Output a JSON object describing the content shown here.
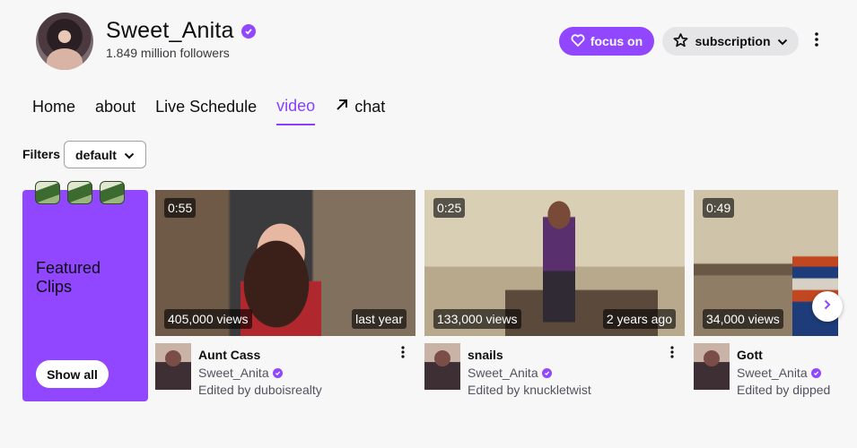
{
  "channel": {
    "name": "Sweet_Anita",
    "followers": "1.849 million followers",
    "verified_icon": "verified-check-icon"
  },
  "actions": {
    "follow_label": "focus on",
    "follow_icon": "heart-icon",
    "subscribe_label": "subscription",
    "subscribe_icon": "star-icon",
    "more_icon": "vertical-dots-icon"
  },
  "tabs": [
    {
      "label": "Home"
    },
    {
      "label": "about"
    },
    {
      "label": "Live Schedule"
    },
    {
      "label": "video",
      "active": true
    },
    {
      "label": "chat",
      "icon": "external-arrow-icon"
    }
  ],
  "filters": {
    "label": "Filters",
    "selected": "default"
  },
  "featured": {
    "title": "Featured Clips",
    "button": "Show all"
  },
  "clips": [
    {
      "duration": "0:55",
      "views": "405,000 views",
      "age": "last year",
      "title": "Aunt Cass",
      "channel": "Sweet_Anita",
      "editor": "Edited by duboisrealty"
    },
    {
      "duration": "0:25",
      "views": "133,000 views",
      "age": "2 years ago",
      "title": "snails",
      "channel": "Sweet_Anita",
      "editor": "Edited by knuckletwist"
    },
    {
      "duration": "0:49",
      "views": "34,000 views",
      "age": "",
      "title": "Gott",
      "channel": "Sweet_Anita",
      "editor": "Edited by dipped"
    }
  ],
  "colors": {
    "accent": "#9147ff",
    "tab_active": "#8a3ffc"
  }
}
